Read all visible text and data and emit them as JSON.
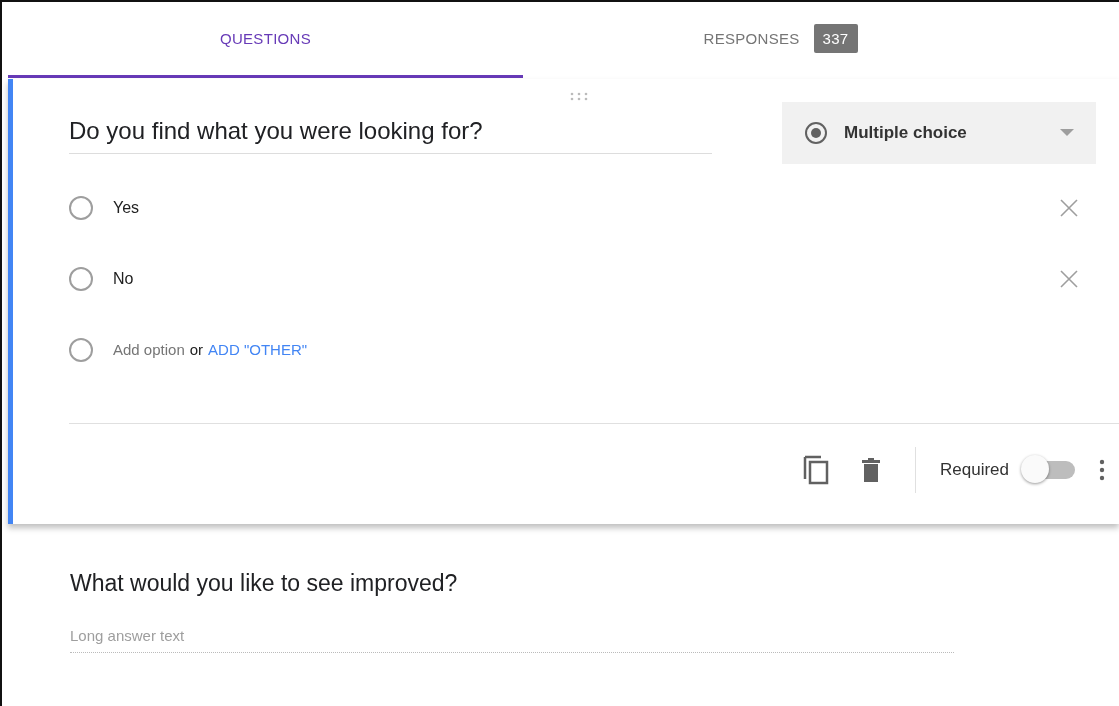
{
  "tabs": [
    {
      "label": "QUESTIONS",
      "selected": true
    },
    {
      "label": "RESPONSES",
      "badge": "337",
      "selected": false
    }
  ],
  "question_card": {
    "title": "Do you find what you were looking for?",
    "type": "Multiple choice",
    "options": [
      {
        "label": "Yes",
        "selected": false
      },
      {
        "label": "No",
        "selected": false
      }
    ],
    "add_option": {
      "selected": false,
      "text": "Add option",
      "joiner": "or",
      "link": "ADD \"OTHER\""
    },
    "required": {
      "label": "Required",
      "on": false
    }
  },
  "second_question": {
    "title": "What would you like to see improved?",
    "placeholder": "Long answer text"
  }
}
